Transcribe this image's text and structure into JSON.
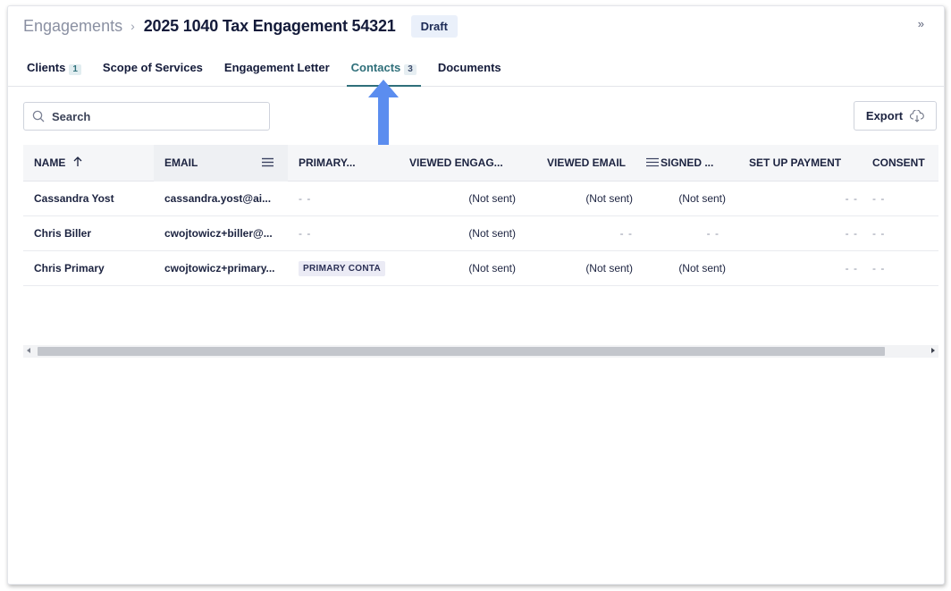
{
  "breadcrumb": {
    "root": "Engagements",
    "separator": "›",
    "title": "2025 1040 Tax Engagement 54321"
  },
  "status": "Draft",
  "collapse_label": "»",
  "tabs": [
    {
      "label": "Clients",
      "count": "1"
    },
    {
      "label": "Scope of Services",
      "count": ""
    },
    {
      "label": "Engagement Letter",
      "count": ""
    },
    {
      "label": "Contacts",
      "count": "3",
      "active": true
    },
    {
      "label": "Documents",
      "count": ""
    }
  ],
  "search": {
    "placeholder": "Search",
    "icon": "search-icon"
  },
  "export": {
    "label": "Export",
    "icon": "cloud-download-icon"
  },
  "table": {
    "columns": [
      {
        "label": "NAME",
        "sort": "asc"
      },
      {
        "label": "EMAIL"
      },
      {
        "label": "PRIMARY..."
      },
      {
        "label": "VIEWED ENGAG..."
      },
      {
        "label": "VIEWED EMAIL"
      },
      {
        "label": "SIGNED ..."
      },
      {
        "label": "SET UP PAYMENT"
      },
      {
        "label": "CONSENT"
      }
    ],
    "rows": [
      {
        "name": "Cassandra Yost",
        "email": "cassandra.yost@ai...",
        "primary": "- -",
        "viewed_engagement": "(Not sent)",
        "viewed_email": "(Not sent)",
        "signed": "(Not sent)",
        "set_up_payment": "- -",
        "consent": "- -"
      },
      {
        "name": "Chris Biller",
        "email": "cwojtowicz+biller@...",
        "primary": "- -",
        "viewed_engagement": "(Not sent)",
        "viewed_email": "- -",
        "signed": "- -",
        "set_up_payment": "- -",
        "consent": "- -"
      },
      {
        "name": "Chris Primary",
        "email": "cwojtowicz+primary...",
        "primary": "PRIMARY CONTA",
        "viewed_engagement": "(Not sent)",
        "viewed_email": "(Not sent)",
        "signed": "(Not sent)",
        "set_up_payment": "- -",
        "consent": "- -"
      }
    ]
  },
  "colors": {
    "accent": "#2f6f7a",
    "annotation_arrow": "#5b8def",
    "text": "#1c2340"
  }
}
